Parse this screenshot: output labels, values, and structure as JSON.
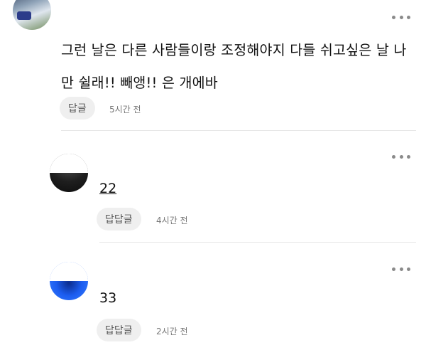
{
  "comments": [
    {
      "text": "그런 날은 다른 사람들이랑 조정해야지 다들 쉬고싶은 날 나만 쉴래!! 빼앵!! 은 개에바",
      "reply_label": "답글",
      "time": "5시간 전"
    },
    {
      "text": "22",
      "reply_label": "답답글",
      "time": "4시간 전"
    },
    {
      "text": "33",
      "reply_label": "답답글",
      "time": "2시간 전"
    }
  ],
  "icons": {
    "more": "more-options-icon",
    "avatar": "avatar"
  },
  "colors": {
    "background": "#ffffff",
    "reply_button": "#efefef",
    "divider": "#e6e6e6",
    "text": "#111111",
    "meta": "#777777"
  }
}
